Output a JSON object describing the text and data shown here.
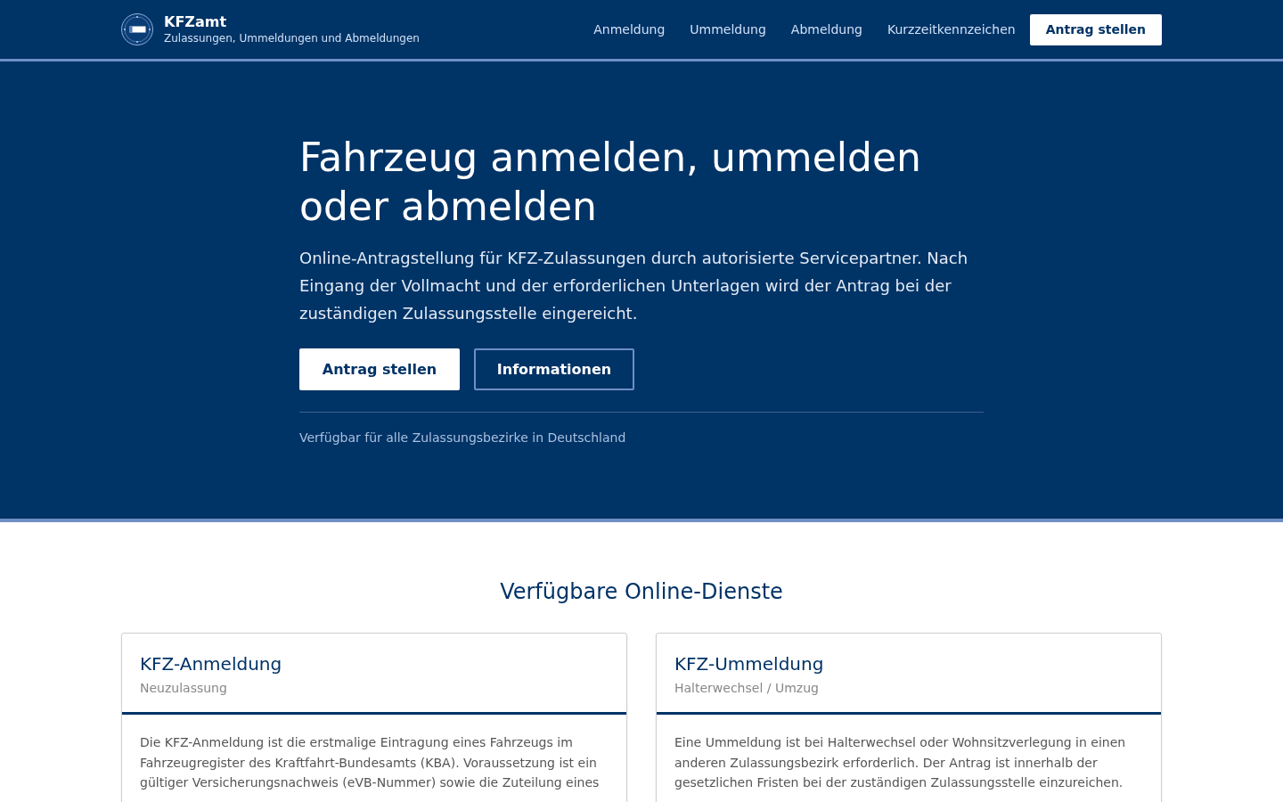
{
  "header": {
    "logo": {
      "title": "KFZamt",
      "subtitle": "Zulassungen, Ummeldungen und Abmeldungen"
    },
    "nav": [
      "Anmeldung",
      "Ummeldung",
      "Abmeldung",
      "Kurzzeitkennzeichen"
    ],
    "cta": "Antrag stellen"
  },
  "hero": {
    "title": "Fahrzeug anmelden, ummelden oder abmelden",
    "text": "Online-Antragstellung für KFZ-Zulassungen durch autorisierte Servicepartner. Nach Eingang der Vollmacht und der erforderlichen Unterlagen wird der Antrag bei der zuständigen Zulassungsstelle eingereicht.",
    "buttons": [
      {
        "label": "Antrag stellen",
        "kind": "primary"
      },
      {
        "label": "Informationen",
        "kind": "secondary"
      }
    ],
    "note": "Verfügbar für alle Zulassungsbezirke in Deutschland"
  },
  "services": {
    "title": "Verfügbare Online-Dienste",
    "cards": [
      {
        "title": "KFZ-Anmeldung",
        "subtitle": "Neuzulassung",
        "text": "Die KFZ-Anmeldung ist die erstmalige Eintragung eines Fahrzeugs im Fahrzeugregister des Kraftfahrt-Bundesamts (KBA). Voraussetzung ist ein gültiger Versicherungsnachweis (eVB-Nummer) sowie die Zuteilung eines"
      },
      {
        "title": "KFZ-Ummeldung",
        "subtitle": "Halterwechsel / Umzug",
        "text": "Eine Ummeldung ist bei Halterwechsel oder Wohnsitzverlegung in einen anderen Zulassungsbezirk erforderlich. Der Antrag ist innerhalb der gesetzlichen Fristen bei der zuständigen Zulassungsstelle einzureichen."
      }
    ]
  }
}
